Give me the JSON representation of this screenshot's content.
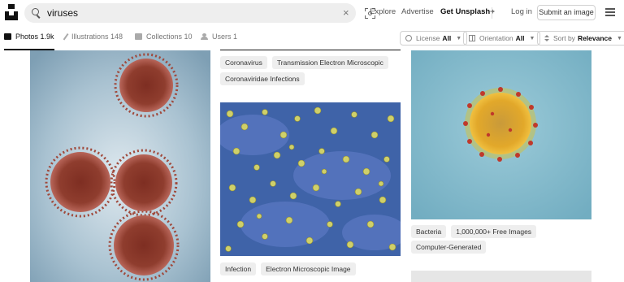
{
  "search": {
    "value": "viruses",
    "clear_symbol": "×"
  },
  "nav": {
    "explore": "Explore",
    "advertise": "Advertise",
    "get_plus": "Get Unsplash+",
    "login": "Log in",
    "submit": "Submit an image"
  },
  "tabs": [
    {
      "label": "Photos",
      "count": "1.9k",
      "active": true
    },
    {
      "label": "Illustrations",
      "count": "148"
    },
    {
      "label": "Collections",
      "count": "10"
    },
    {
      "label": "Users",
      "count": "1"
    }
  ],
  "filters": {
    "license_label": "License",
    "license_value": "All",
    "orientation_label": "Orientation",
    "orientation_value": "All",
    "sort_label": "Sort by",
    "sort_value": "Relevance"
  },
  "middle_top_tags": [
    "Coronavirus",
    "Transmission Electron Microscopic",
    "Coronaviridae Infections"
  ],
  "middle_bottom_tags": [
    "Infection",
    "Electron Microscopic Image"
  ],
  "right_tags": [
    "Bacteria",
    "1,000,000+ Free Images",
    "Computer-Generated"
  ],
  "colors": {
    "accent": "#111111",
    "tag_bg": "#eeeeee",
    "border": "#d1d1d1"
  }
}
